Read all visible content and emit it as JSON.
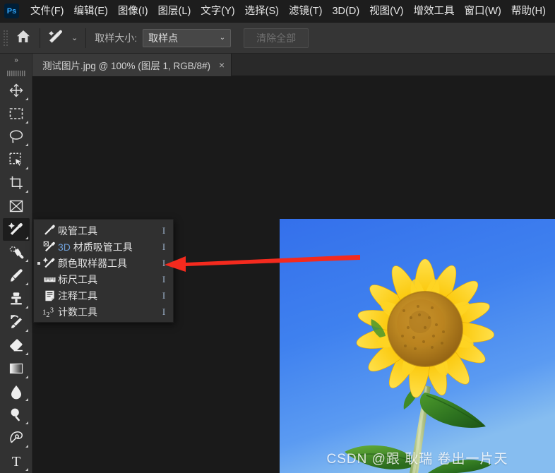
{
  "app": {
    "name": "Adobe Photoshop",
    "logo_text": "Ps",
    "logo_color": "#31a8ff"
  },
  "menubar": {
    "items": [
      {
        "label": "文件(F)"
      },
      {
        "label": "编辑(E)"
      },
      {
        "label": "图像(I)"
      },
      {
        "label": "图层(L)"
      },
      {
        "label": "文字(Y)"
      },
      {
        "label": "选择(S)"
      },
      {
        "label": "滤镜(T)"
      },
      {
        "label": "3D(D)"
      },
      {
        "label": "视图(V)"
      },
      {
        "label": "增效工具"
      },
      {
        "label": "窗口(W)"
      },
      {
        "label": "帮助(H)"
      }
    ]
  },
  "options_bar": {
    "home_icon": "home-icon",
    "tool_icon": "color-sampler-icon",
    "tool_preset_caret": "⌄",
    "sample_size_label": "取样大小:",
    "sample_size_value": "取样点",
    "sample_size_caret": "⌄",
    "clear_all_label": "清除全部"
  },
  "toolbar": {
    "collapse_icon": "double-chevron-right-icon",
    "handle": "drag-handle",
    "tools": [
      {
        "name": "move-tool",
        "icon": "move-icon",
        "active": false,
        "has_flyout": true
      },
      {
        "name": "marquee-tool",
        "icon": "rectangular-marquee-icon",
        "active": false,
        "has_flyout": true
      },
      {
        "name": "lasso-tool",
        "icon": "lasso-icon",
        "active": false,
        "has_flyout": true
      },
      {
        "name": "quick-selection-tool",
        "icon": "quick-selection-icon",
        "active": false,
        "has_flyout": true
      },
      {
        "name": "crop-tool",
        "icon": "crop-icon",
        "active": false,
        "has_flyout": true
      },
      {
        "name": "frame-tool",
        "icon": "frame-icon",
        "active": false,
        "has_flyout": false
      },
      {
        "name": "eyedropper-tool",
        "icon": "color-sampler-icon",
        "active": true,
        "has_flyout": true
      },
      {
        "name": "healing-brush-tool",
        "icon": "healing-brush-icon",
        "active": false,
        "has_flyout": true
      },
      {
        "name": "brush-tool",
        "icon": "brush-icon",
        "active": false,
        "has_flyout": true
      },
      {
        "name": "clone-stamp-tool",
        "icon": "clone-stamp-icon",
        "active": false,
        "has_flyout": true
      },
      {
        "name": "history-brush-tool",
        "icon": "history-brush-icon",
        "active": false,
        "has_flyout": true
      },
      {
        "name": "eraser-tool",
        "icon": "eraser-icon",
        "active": false,
        "has_flyout": true
      },
      {
        "name": "gradient-tool",
        "icon": "gradient-icon",
        "active": false,
        "has_flyout": true
      },
      {
        "name": "blur-tool",
        "icon": "blur-drop-icon",
        "active": false,
        "has_flyout": true
      },
      {
        "name": "dodge-tool",
        "icon": "dodge-icon",
        "active": false,
        "has_flyout": true
      },
      {
        "name": "pen-tool",
        "icon": "pen-icon",
        "active": false,
        "has_flyout": true
      },
      {
        "name": "type-tool",
        "icon": "type-t-icon",
        "active": false,
        "has_flyout": true
      }
    ]
  },
  "document_tab": {
    "title": "测试图片.jpg @ 100% (图层 1, RGB/8#)",
    "close_icon": "×"
  },
  "flyout_menu": {
    "items": [
      {
        "icon": "eyedropper-icon",
        "label": "吸管工具",
        "label_prefix": "",
        "shortcut": "I",
        "selected": false
      },
      {
        "icon": "3d-material-eyedropper-icon",
        "label": " 材质吸管工具",
        "label_prefix": "3D",
        "shortcut": "I",
        "selected": false
      },
      {
        "icon": "color-sampler-icon",
        "label": "颜色取样器工具",
        "label_prefix": "",
        "shortcut": "I",
        "selected": true
      },
      {
        "icon": "ruler-icon",
        "label": "标尺工具",
        "label_prefix": "",
        "shortcut": "I",
        "selected": false
      },
      {
        "icon": "note-icon",
        "label": "注释工具",
        "label_prefix": "",
        "shortcut": "I",
        "selected": false
      },
      {
        "icon": "count-123-icon",
        "label": "计数工具",
        "label_prefix": "",
        "shortcut": "I",
        "selected": false
      }
    ]
  },
  "annotation": {
    "arrow_color": "#f42a1e",
    "arrow_name": "red-pointer-arrow"
  },
  "canvas": {
    "background_color": "#1a1a1a",
    "image": {
      "name": "sunflower-photo",
      "sky_color": "#3b7ced",
      "petal_color": "#f5c400",
      "disc_color": "#b07a18",
      "stem_color": "#a9c27a",
      "leaf_color": "#2f7a24"
    },
    "watermark": "CSDN @跟 耿瑞 卷出一片天"
  }
}
